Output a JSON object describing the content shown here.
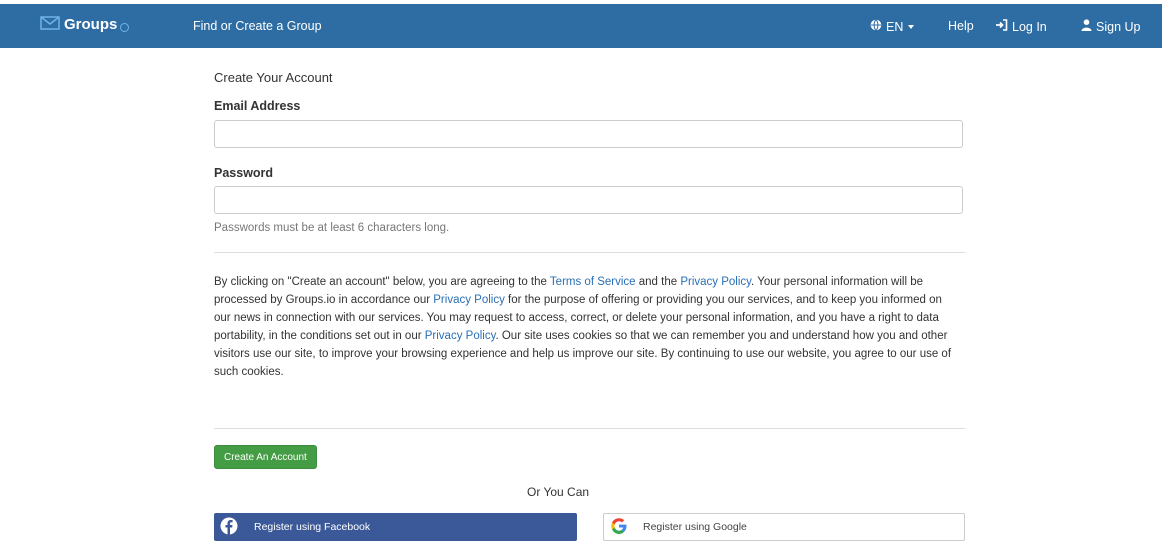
{
  "nav": {
    "brand": "Groups",
    "find": "Find or Create a Group",
    "lang": "EN",
    "help": "Help",
    "login": "Log In",
    "signup": "Sign Up"
  },
  "form": {
    "title": "Create Your Account",
    "email_label": "Email Address",
    "email_value": "",
    "password_label": "Password",
    "password_value": "",
    "password_help": "Passwords must be at least 6 characters long."
  },
  "legal": {
    "p1": "By clicking on \"Create an account\" below, you are agreeing to the ",
    "terms_link": "Terms of Service",
    "p2": " and the ",
    "privacy_link1": "Privacy Policy",
    "p3": ". Your personal information will be processed by Groups.io in accordance our ",
    "privacy_link2": "Privacy Policy",
    "p4": " for the purpose of offering or providing you our services, and to keep you informed on our news in connection with our services. You may request to access, correct, or delete your personal information, and you have a right to data portability, in the conditions set out in our ",
    "privacy_link3": "Privacy Policy",
    "p5": ". Our site uses cookies so that we can remember you and understand how you and other visitors use our site, to improve your browsing experience and help us improve our site. By continuing to use our website, you agree to our use of such cookies."
  },
  "buttons": {
    "create": "Create An Account",
    "or": "Or You Can",
    "facebook": "Register using Facebook",
    "google": "Register using Google"
  },
  "colors": {
    "navbar": "#2e6da4",
    "create_button": "#449d44",
    "facebook": "#3b5998",
    "link": "#2a6fb6"
  }
}
